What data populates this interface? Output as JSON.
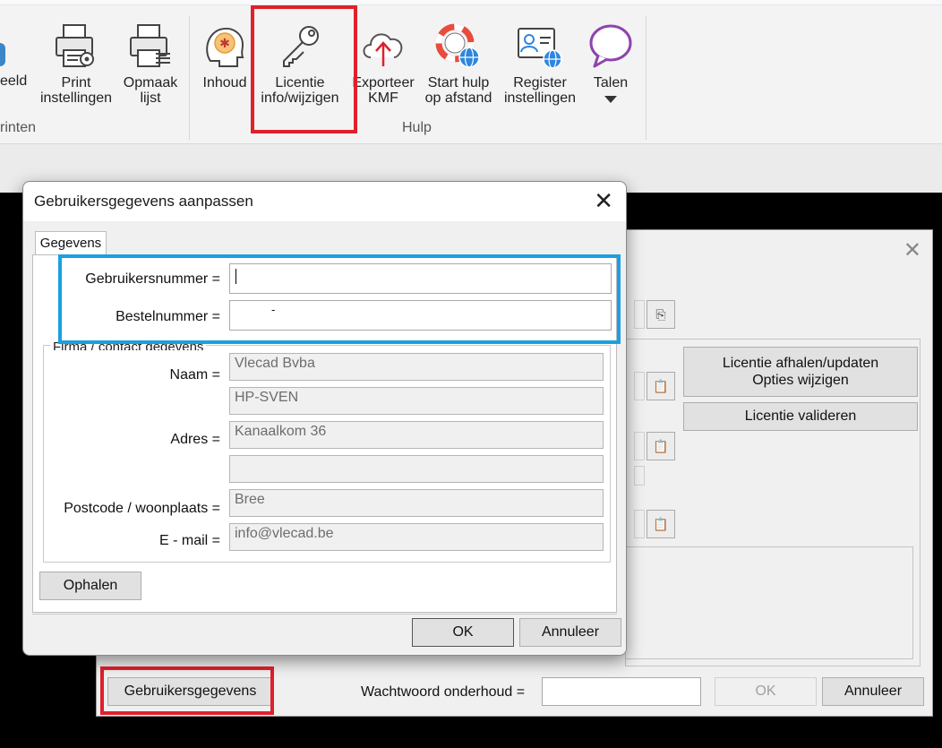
{
  "ribbon": {
    "buttons": [
      {
        "id": "voorbeeld",
        "label": "eeld"
      },
      {
        "id": "print",
        "label1": "Print",
        "label2": "instellingen"
      },
      {
        "id": "opmaak",
        "label1": "Opmaak",
        "label2": "lijst"
      },
      {
        "id": "inhoud",
        "label": "Inhoud"
      },
      {
        "id": "licentie",
        "label1": "Licentie",
        "label2": "info/wijzigen"
      },
      {
        "id": "exporteer",
        "label1": "Exporteer",
        "label2": "KMF"
      },
      {
        "id": "starthulp",
        "label1": "Start hulp",
        "label2": "op afstand"
      },
      {
        "id": "register",
        "label1": "Register",
        "label2": "instellingen"
      },
      {
        "id": "talen",
        "label": "Talen"
      }
    ],
    "groups": {
      "printen": "rinten",
      "hulp": "Hulp"
    }
  },
  "background_dialog": {
    "buttons": {
      "licentie_afhalen_1": "Licentie afhalen/updaten",
      "licentie_afhalen_2": "Opties wijzigen",
      "licentie_valideren": "Licentie valideren",
      "gebruikersgegevens": "Gebruikersgegevens",
      "ok": "OK",
      "annuleer": "Annuleer"
    },
    "wachtwoord_label": "Wachtwoord onderhoud =",
    "wachtwoord_value": ""
  },
  "dialog": {
    "title": "Gebruikersgegevens aanpassen",
    "tab": "Gegevens",
    "labels": {
      "gebruikersnummer": "Gebruikersnummer =",
      "bestelnummer": "Bestelnummer =",
      "legend": "Firma / contact gegevens",
      "naam": "Naam =",
      "adres": "Adres =",
      "postcode": "Postcode / woonplaats =",
      "email": "E - mail ="
    },
    "values": {
      "gebruikersnummer": "",
      "bestelnummer": "-",
      "naam1": "Vlecad Bvba",
      "naam2": "HP-SVEN",
      "adres1": "Kanaalkom 36",
      "adres2": "",
      "postcode": "Bree",
      "email": "info@vlecad.be"
    },
    "buttons": {
      "ophalen": "Ophalen",
      "ok": "OK",
      "annuleer": "Annuleer"
    }
  },
  "colors": {
    "highlight_red": "#e0202a",
    "highlight_blue": "#1aa0e2"
  }
}
